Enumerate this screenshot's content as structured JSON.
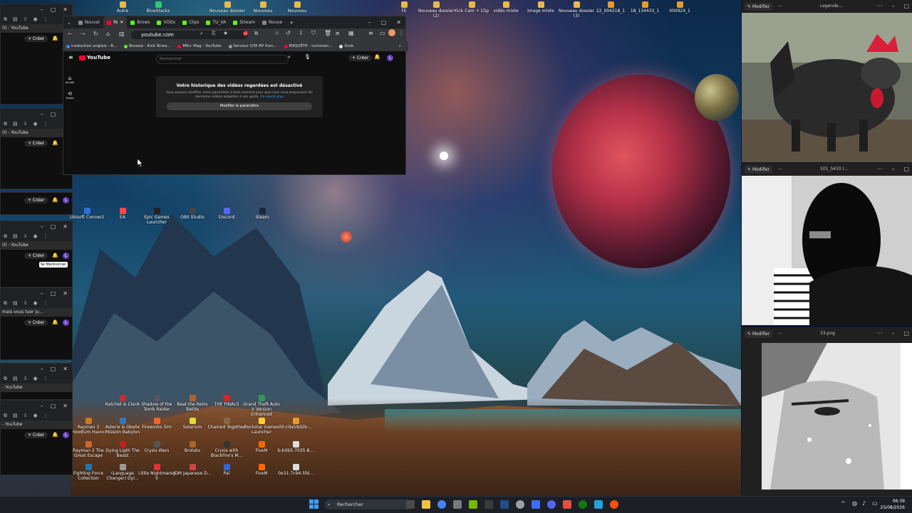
{
  "browser": {
    "tabs": [
      {
        "label": "Nouvel",
        "color": "#888"
      },
      {
        "label": "Yo",
        "color": "#ff0033"
      },
      {
        "label": "Brows",
        "color": "#53fc18"
      },
      {
        "label": "VODs",
        "color": "#53fc18"
      },
      {
        "label": "Clips",
        "color": "#53fc18"
      },
      {
        "label": "TU_VA",
        "color": "#53fc18"
      },
      {
        "label": "Stream",
        "color": "#53fc18"
      },
      {
        "label": "Nouve",
        "color": "#888"
      }
    ],
    "address": "youtube.com",
    "bookmarks": [
      {
        "label": "traduction anglais - R...",
        "color": "#4285f4"
      },
      {
        "label": "Browse - Kick Strea...",
        "color": "#53fc18"
      },
      {
        "label": "M6+ Mag - YouTube",
        "color": "#ff0033"
      },
      {
        "label": "Serveur GTA RP fran...",
        "color": "#999"
      },
      {
        "label": "ENQUÊTE : commen...",
        "color": "#ff0033"
      },
      {
        "label": "Grok",
        "color": "#ddd"
      }
    ],
    "youtube": {
      "logo": "YouTube",
      "search_placeholder": "Rechercher",
      "create_label": "Créer",
      "avatar_letter": "L",
      "side_home": "Accueil",
      "side_shorts": "Shorts",
      "history_title": "Votre historique des vidéos regardées est désactivé",
      "history_body": "Vous pouvez modifier votre paramètre à tout moment pour que nous vous proposions les dernières vidéos adaptées à vos goûts.",
      "history_link": "En savoir plus",
      "history_button": "Modifier le paramètre"
    }
  },
  "left_windows": [
    {
      "title": "(I) - YouTube",
      "create": "Créer",
      "avatar": "L"
    },
    {
      "title": "(I) - YouTube",
      "create": "Créer",
      "avatar": "L"
    },
    {
      "title": "",
      "create": "Créer",
      "avatar": "L"
    },
    {
      "title": "(I) - YouTube",
      "create": "Créer",
      "avatar": "L",
      "tooltip": "Se Mentionner"
    },
    {
      "title": "mais vous tuer ju...",
      "create": "Créer",
      "avatar": "L"
    },
    {
      "title": "- YouTube",
      "create": "Créer",
      "avatar": "L"
    },
    {
      "title": "- YouTube",
      "create": "Créer",
      "avatar": "L"
    }
  ],
  "top_icons": [
    "Autre",
    "BlueStacks",
    "Nouveau dossier",
    "Nouveau",
    "Nouveau",
    "FE",
    "Nouveau dossier (2)",
    "Kick Cam + Clip",
    "vidéo mixte",
    "image mixte",
    "Nouveau dossier (3)",
    "22_004218_1",
    "18_134433_1",
    "000924_1"
  ],
  "desktop_icons_row1": [
    "Ubisoft Connect",
    "EA",
    "Epic Games Launcher",
    "OBS Studio",
    "Discord",
    "Steam"
  ],
  "desktop_icons_bottom": [
    [
      "Ratchet & Clank",
      "Shadow of the Tomb Raider",
      "Beat the Retro Battle",
      "THE FINALS",
      "Grand Theft Auto V Version Enhanced"
    ],
    [
      "Rayman 3 Hoodlum Havoc",
      "Asterix & Obelix Mission Babylon",
      "Fireworks Sim",
      "Solarium",
      "Chained Together",
      "Rockstar Games Launcher",
      "00-c9a59d2b-..."
    ],
    [
      "Rayman 2 The Great Escape",
      "Dying Light The Beast",
      "Crysis Wars",
      "Brotato",
      "Crysis with BlackFire's M...",
      "FiveM",
      "b-b0b5-7035-8..."
    ],
    [
      "Fighting Force Collection",
      "(Language Changer) Dyi...",
      "Little Nightmares II",
      "JDM Japanese D...",
      "Pal",
      "FiveM",
      "0e31-7c94-5fd..."
    ]
  ],
  "photo_windows": [
    {
      "edit": "Modifier",
      "title": "Legende..."
    },
    {
      "edit": "Modifier",
      "title": "101_5410 (..."
    },
    {
      "edit": "Modifier",
      "title": "33.png"
    }
  ],
  "taskbar": {
    "search": "Rechercher",
    "time": "06:39",
    "date": "25/08/2026",
    "icon_colors": [
      "#f4c242",
      "#4285f4",
      "#7a7a7a",
      "#76b900",
      "#3a3a3a",
      "#1f4e8c",
      "#9aa0a6",
      "#3b6ef5",
      "#5865f2",
      "#e74c3c",
      "#107c10",
      "#26a0da",
      "#2d7dd2",
      "#ff4f00"
    ]
  },
  "colors": {
    "youtube_red": "#ff0033",
    "kick_green": "#53fc18",
    "avatar_purple": "#6a3fc2"
  }
}
